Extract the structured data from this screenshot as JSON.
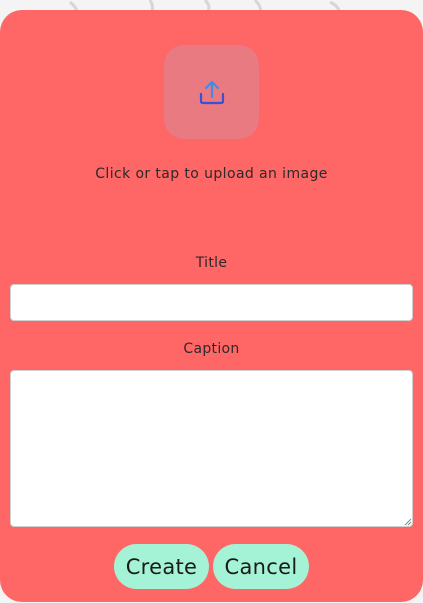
{
  "colors": {
    "card_background": "#ff6666",
    "upload_tile": "#e97a82",
    "upload_icon": "#3b6fd8",
    "button_background": "#a5f3d6"
  },
  "upload": {
    "icon": "upload-icon",
    "hint": "Click or tap to upload an image"
  },
  "form": {
    "title_label": "Title",
    "title_value": "",
    "caption_label": "Caption",
    "caption_value": ""
  },
  "actions": {
    "create_label": "Create",
    "cancel_label": "Cancel"
  }
}
